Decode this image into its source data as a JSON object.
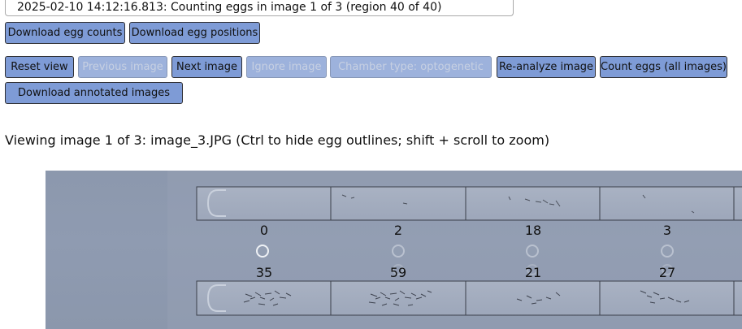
{
  "status": "2025-02-10 14:12:16.813: Counting eggs in image 1 of 3 (region 40 of 40)",
  "download_buttons": {
    "egg_counts": "Download egg counts",
    "egg_positions": "Download egg positions"
  },
  "toolbar": {
    "reset_view": "Reset view",
    "previous_image": "Previous image",
    "next_image": "Next image",
    "ignore_image": "Ignore image",
    "chamber_type": "Chamber type: optogenetic",
    "reanalyze_image": "Re-analyze image",
    "count_eggs_all": "Count eggs (all images)",
    "download_annotated": "Download annotated images"
  },
  "viewing_text": "Viewing image 1 of 3: image_3.JPG (Ctrl to hide egg outlines; shift + scroll to zoom)",
  "egg_counts": {
    "top_row": [
      "0",
      "2",
      "18",
      "3"
    ],
    "bottom_row": [
      "35",
      "59",
      "21",
      "27"
    ]
  },
  "colors": {
    "button": "#7e9bd6",
    "button_disabled": "#9db2dc",
    "photo_background": "#8f9bb1"
  }
}
